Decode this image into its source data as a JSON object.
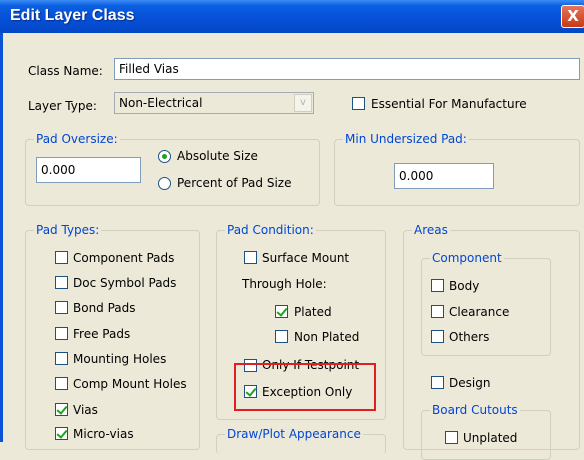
{
  "window": {
    "title": "Edit Layer Class",
    "close_glyph": "X"
  },
  "class_name": {
    "label": "Class Name:",
    "value": "Filled Vias"
  },
  "layer_type": {
    "label": "Layer Type:",
    "value": "Non-Electrical",
    "arrow_glyph": "v"
  },
  "essential": {
    "label": "Essential For Manufacture",
    "checked": false
  },
  "pad_oversize": {
    "title": "Pad Oversize:",
    "value": "0.000",
    "options": [
      {
        "label": "Absolute Size",
        "selected": true
      },
      {
        "label": "Percent of Pad Size",
        "selected": false
      }
    ]
  },
  "min_undersized": {
    "title": "Min Undersized Pad:",
    "value": "0.000"
  },
  "pad_types": {
    "title": "Pad Types:",
    "items": [
      {
        "label": "Component Pads",
        "checked": false
      },
      {
        "label": "Doc Symbol Pads",
        "checked": false
      },
      {
        "label": "Bond Pads",
        "checked": false
      },
      {
        "label": "Free Pads",
        "checked": false
      },
      {
        "label": "Mounting Holes",
        "checked": false
      },
      {
        "label": "Comp Mount Holes",
        "checked": false
      },
      {
        "label": "Vias",
        "checked": true
      },
      {
        "label": "Micro-vias",
        "checked": true
      }
    ]
  },
  "pad_condition": {
    "title": "Pad Condition:",
    "surface_mount": {
      "label": "Surface Mount",
      "checked": false
    },
    "through_hole_label": "Through Hole:",
    "plated": {
      "label": "Plated",
      "checked": true
    },
    "non_plated": {
      "label": "Non Plated",
      "checked": false
    },
    "only_if_testpoint": {
      "label": "Only If Testpoint",
      "checked": false
    },
    "exception_only": {
      "label": "Exception Only",
      "checked": true
    }
  },
  "draw_plot": {
    "title": "Draw/Plot Appearance"
  },
  "areas": {
    "title": "Areas",
    "component": {
      "title": "Component",
      "items": [
        {
          "label": "Body",
          "checked": false
        },
        {
          "label": "Clearance",
          "checked": false
        },
        {
          "label": "Others",
          "checked": false
        }
      ]
    },
    "design": {
      "label": "Design",
      "checked": false
    },
    "board_cutouts": {
      "title": "Board Cutouts",
      "items": [
        {
          "label": "Unplated",
          "checked": false
        }
      ]
    }
  },
  "colors": {
    "title_bar": "#0650d8",
    "dialog_bg": "#ece9d8",
    "group_label": "#0046d5",
    "highlight": "#e02020",
    "check": "#21a121"
  }
}
